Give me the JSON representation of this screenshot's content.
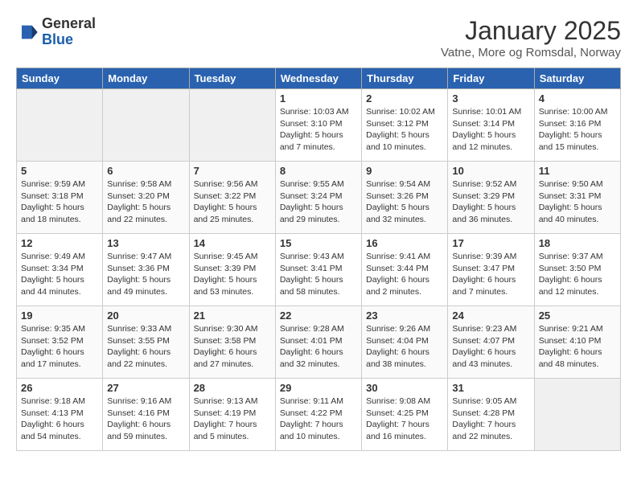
{
  "header": {
    "logo_general": "General",
    "logo_blue": "Blue",
    "month_title": "January 2025",
    "location": "Vatne, More og Romsdal, Norway"
  },
  "days_of_week": [
    "Sunday",
    "Monday",
    "Tuesday",
    "Wednesday",
    "Thursday",
    "Friday",
    "Saturday"
  ],
  "weeks": [
    [
      {
        "day": "",
        "info": ""
      },
      {
        "day": "",
        "info": ""
      },
      {
        "day": "",
        "info": ""
      },
      {
        "day": "1",
        "info": "Sunrise: 10:03 AM\nSunset: 3:10 PM\nDaylight: 5 hours and 7 minutes."
      },
      {
        "day": "2",
        "info": "Sunrise: 10:02 AM\nSunset: 3:12 PM\nDaylight: 5 hours and 10 minutes."
      },
      {
        "day": "3",
        "info": "Sunrise: 10:01 AM\nSunset: 3:14 PM\nDaylight: 5 hours and 12 minutes."
      },
      {
        "day": "4",
        "info": "Sunrise: 10:00 AM\nSunset: 3:16 PM\nDaylight: 5 hours and 15 minutes."
      }
    ],
    [
      {
        "day": "5",
        "info": "Sunrise: 9:59 AM\nSunset: 3:18 PM\nDaylight: 5 hours and 18 minutes."
      },
      {
        "day": "6",
        "info": "Sunrise: 9:58 AM\nSunset: 3:20 PM\nDaylight: 5 hours and 22 minutes."
      },
      {
        "day": "7",
        "info": "Sunrise: 9:56 AM\nSunset: 3:22 PM\nDaylight: 5 hours and 25 minutes."
      },
      {
        "day": "8",
        "info": "Sunrise: 9:55 AM\nSunset: 3:24 PM\nDaylight: 5 hours and 29 minutes."
      },
      {
        "day": "9",
        "info": "Sunrise: 9:54 AM\nSunset: 3:26 PM\nDaylight: 5 hours and 32 minutes."
      },
      {
        "day": "10",
        "info": "Sunrise: 9:52 AM\nSunset: 3:29 PM\nDaylight: 5 hours and 36 minutes."
      },
      {
        "day": "11",
        "info": "Sunrise: 9:50 AM\nSunset: 3:31 PM\nDaylight: 5 hours and 40 minutes."
      }
    ],
    [
      {
        "day": "12",
        "info": "Sunrise: 9:49 AM\nSunset: 3:34 PM\nDaylight: 5 hours and 44 minutes."
      },
      {
        "day": "13",
        "info": "Sunrise: 9:47 AM\nSunset: 3:36 PM\nDaylight: 5 hours and 49 minutes."
      },
      {
        "day": "14",
        "info": "Sunrise: 9:45 AM\nSunset: 3:39 PM\nDaylight: 5 hours and 53 minutes."
      },
      {
        "day": "15",
        "info": "Sunrise: 9:43 AM\nSunset: 3:41 PM\nDaylight: 5 hours and 58 minutes."
      },
      {
        "day": "16",
        "info": "Sunrise: 9:41 AM\nSunset: 3:44 PM\nDaylight: 6 hours and 2 minutes."
      },
      {
        "day": "17",
        "info": "Sunrise: 9:39 AM\nSunset: 3:47 PM\nDaylight: 6 hours and 7 minutes."
      },
      {
        "day": "18",
        "info": "Sunrise: 9:37 AM\nSunset: 3:50 PM\nDaylight: 6 hours and 12 minutes."
      }
    ],
    [
      {
        "day": "19",
        "info": "Sunrise: 9:35 AM\nSunset: 3:52 PM\nDaylight: 6 hours and 17 minutes."
      },
      {
        "day": "20",
        "info": "Sunrise: 9:33 AM\nSunset: 3:55 PM\nDaylight: 6 hours and 22 minutes."
      },
      {
        "day": "21",
        "info": "Sunrise: 9:30 AM\nSunset: 3:58 PM\nDaylight: 6 hours and 27 minutes."
      },
      {
        "day": "22",
        "info": "Sunrise: 9:28 AM\nSunset: 4:01 PM\nDaylight: 6 hours and 32 minutes."
      },
      {
        "day": "23",
        "info": "Sunrise: 9:26 AM\nSunset: 4:04 PM\nDaylight: 6 hours and 38 minutes."
      },
      {
        "day": "24",
        "info": "Sunrise: 9:23 AM\nSunset: 4:07 PM\nDaylight: 6 hours and 43 minutes."
      },
      {
        "day": "25",
        "info": "Sunrise: 9:21 AM\nSunset: 4:10 PM\nDaylight: 6 hours and 48 minutes."
      }
    ],
    [
      {
        "day": "26",
        "info": "Sunrise: 9:18 AM\nSunset: 4:13 PM\nDaylight: 6 hours and 54 minutes."
      },
      {
        "day": "27",
        "info": "Sunrise: 9:16 AM\nSunset: 4:16 PM\nDaylight: 6 hours and 59 minutes."
      },
      {
        "day": "28",
        "info": "Sunrise: 9:13 AM\nSunset: 4:19 PM\nDaylight: 7 hours and 5 minutes."
      },
      {
        "day": "29",
        "info": "Sunrise: 9:11 AM\nSunset: 4:22 PM\nDaylight: 7 hours and 10 minutes."
      },
      {
        "day": "30",
        "info": "Sunrise: 9:08 AM\nSunset: 4:25 PM\nDaylight: 7 hours and 16 minutes."
      },
      {
        "day": "31",
        "info": "Sunrise: 9:05 AM\nSunset: 4:28 PM\nDaylight: 7 hours and 22 minutes."
      },
      {
        "day": "",
        "info": ""
      }
    ]
  ]
}
